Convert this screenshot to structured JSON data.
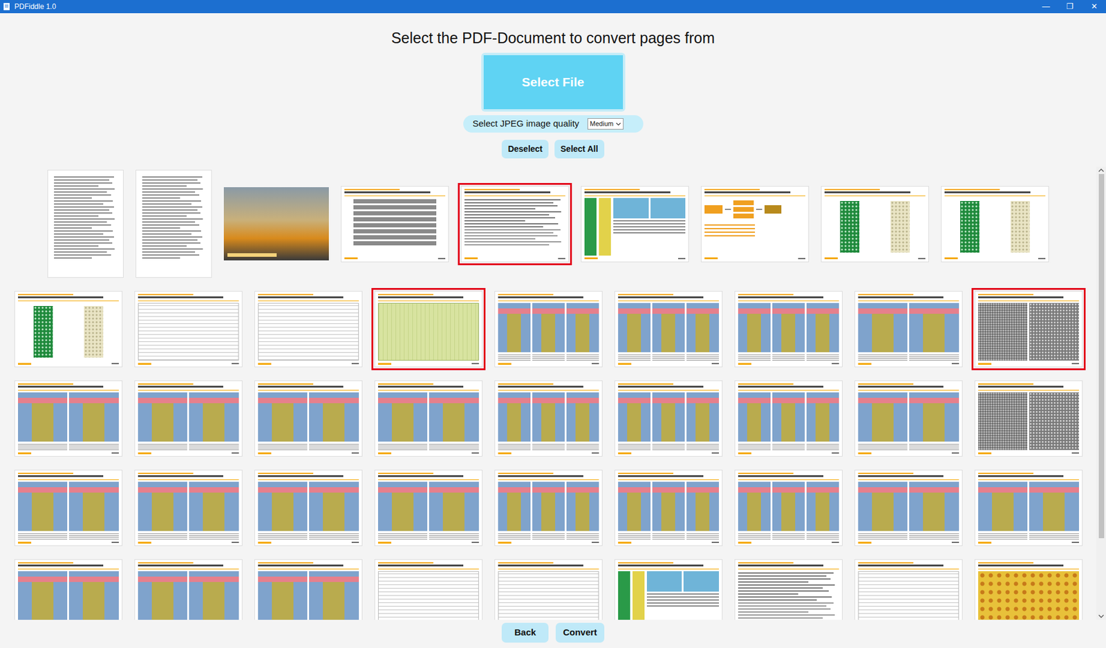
{
  "window": {
    "title": "PDFiddle 1.0",
    "controls": [
      "—",
      "❐",
      "✕"
    ]
  },
  "heading": "Select the PDF-Document to convert pages from",
  "select_file": "Select File",
  "quality": {
    "label": "Select JPEG image quality",
    "value": "Medium"
  },
  "selection_buttons": [
    "Deselect",
    "Select All"
  ],
  "pages": [
    {
      "kind": "portrait",
      "selected": false
    },
    {
      "kind": "portrait",
      "selected": false
    },
    {
      "kind": "photo",
      "selected": false
    },
    {
      "kind": "toc",
      "selected": false
    },
    {
      "kind": "text",
      "selected": true
    },
    {
      "kind": "mixed",
      "selected": false
    },
    {
      "kind": "flow",
      "selected": false
    },
    {
      "kind": "board",
      "selected": false
    },
    {
      "kind": "board",
      "selected": false
    },
    {
      "kind": "board",
      "selected": false
    },
    {
      "kind": "table",
      "selected": false
    },
    {
      "kind": "table",
      "selected": false
    },
    {
      "kind": "panel",
      "selected": true
    },
    {
      "kind": "triple",
      "selected": false
    },
    {
      "kind": "triple",
      "selected": false
    },
    {
      "kind": "triple",
      "selected": false
    },
    {
      "kind": "pair",
      "selected": false
    },
    {
      "kind": "sem",
      "selected": true
    },
    {
      "kind": "pair",
      "selected": false
    },
    {
      "kind": "pair",
      "selected": false
    },
    {
      "kind": "pair",
      "selected": false
    },
    {
      "kind": "pair",
      "selected": false
    },
    {
      "kind": "triple",
      "selected": false
    },
    {
      "kind": "triple",
      "selected": false
    },
    {
      "kind": "triple",
      "selected": false
    },
    {
      "kind": "pair",
      "selected": false
    },
    {
      "kind": "sem",
      "selected": false
    },
    {
      "kind": "pair",
      "selected": false
    },
    {
      "kind": "pair",
      "selected": false
    },
    {
      "kind": "pair",
      "selected": false
    },
    {
      "kind": "pair",
      "selected": false
    },
    {
      "kind": "triple",
      "selected": false
    },
    {
      "kind": "triple",
      "selected": false
    },
    {
      "kind": "triple",
      "selected": false
    },
    {
      "kind": "pair",
      "selected": false
    },
    {
      "kind": "pair",
      "selected": false
    },
    {
      "kind": "pair",
      "selected": false
    },
    {
      "kind": "pair",
      "selected": false
    },
    {
      "kind": "pair",
      "selected": false
    },
    {
      "kind": "table",
      "selected": false
    },
    {
      "kind": "table",
      "selected": false
    },
    {
      "kind": "mixed",
      "selected": false
    },
    {
      "kind": "text",
      "selected": false
    },
    {
      "kind": "table",
      "selected": false
    },
    {
      "kind": "grid",
      "selected": false
    }
  ],
  "scrollbar": {
    "level": 0.83
  },
  "footer_buttons": [
    "Back",
    "Convert"
  ]
}
